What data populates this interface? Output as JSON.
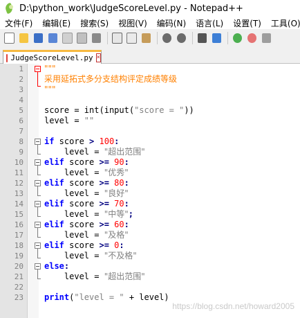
{
  "window": {
    "title": "D:\\python_work\\JudgeScoreLevel.py - Notepad++"
  },
  "menu": [
    "文件(F)",
    "编辑(E)",
    "搜索(S)",
    "视图(V)",
    "编码(N)",
    "语言(L)",
    "设置(T)",
    "工具(O)"
  ],
  "toolbar_icons": [
    "new-file-icon",
    "open-file-icon",
    "save-icon",
    "save-all-icon",
    "close-icon",
    "close-all-icon",
    "print-icon",
    "cut-icon",
    "copy-icon",
    "paste-icon",
    "undo-icon",
    "redo-icon",
    "find-icon",
    "replace-icon",
    "zoom-in-icon",
    "zoom-out-icon",
    "sync-icon"
  ],
  "tab": {
    "label": "JudgeScoreLevel.py",
    "close": "×"
  },
  "code": {
    "l1": "\"\"\"",
    "l2": "采用延拓式多分支结构评定成绩等级",
    "l3": "\"\"\"",
    "l5a": "score = ",
    "l5b": "int",
    "l5c": "(",
    "l5d": "input",
    "l5e": "(",
    "l5s": "\"score = \"",
    "l5f": "))",
    "l6a": "level = ",
    "l6s": "\"\"",
    "l8k": "if",
    "l8a": " score ",
    "l8o": ">",
    "l8n": " 100",
    "l8c": ":",
    "l9a": "    level = ",
    "l9s": "\"超出范围\"",
    "l10k": "elif",
    "l10a": " score ",
    "l10o": ">=",
    "l10n": " 90",
    "l10c": ":",
    "l11a": "    level = ",
    "l11s": "\"优秀\"",
    "l12k": "elif",
    "l12a": " score ",
    "l12o": ">=",
    "l12n": " 80",
    "l12c": ":",
    "l13a": "    level = ",
    "l13s": "\"良好\"",
    "l14k": "elif",
    "l14a": " score ",
    "l14o": ">=",
    "l14n": " 70",
    "l14c": ":",
    "l15a": "    level = ",
    "l15s": "\"中等\"",
    "l15e": ";",
    "l16k": "elif",
    "l16a": " score ",
    "l16o": ">=",
    "l16n": " 60",
    "l16c": ":",
    "l17a": "    level = ",
    "l17s": "\"及格\"",
    "l18k": "elif",
    "l18a": " score ",
    "l18o": ">=",
    "l18n": " 0",
    "l18c": ":",
    "l19a": "    level = ",
    "l19s": "\"不及格\"",
    "l20k": "else",
    "l20c": ":",
    "l21a": "    level = ",
    "l21s": "\"超出范围\"",
    "l23k": "print",
    "l23a": "(",
    "l23s": "\"level = \"",
    "l23b": " + level)"
  },
  "line_numbers": [
    "1",
    "2",
    "3",
    "4",
    "5",
    "6",
    "7",
    "8",
    "9",
    "10",
    "11",
    "12",
    "13",
    "14",
    "15",
    "16",
    "17",
    "18",
    "19",
    "20",
    "21",
    "22",
    "23"
  ],
  "watermark": "https://blog.csdn.net/howard2005"
}
